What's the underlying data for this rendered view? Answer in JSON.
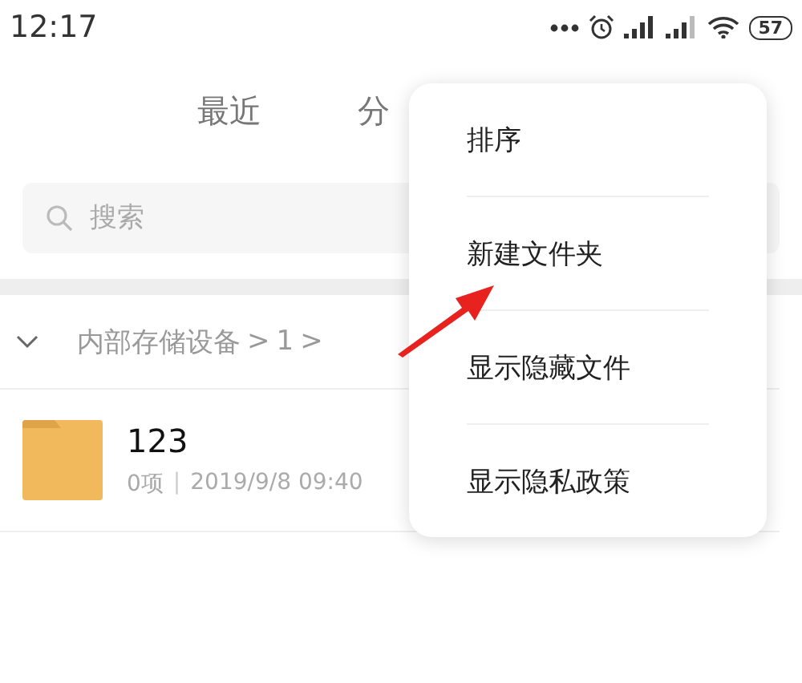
{
  "status_bar": {
    "time": "12:17",
    "battery": "57"
  },
  "tabs": [
    {
      "label": "最近",
      "selected": false
    },
    {
      "label": "分",
      "selected": false
    }
  ],
  "search": {
    "placeholder": "搜索"
  },
  "breadcrumb": [
    "内部存储设备",
    ">",
    "1",
    ">"
  ],
  "files": [
    {
      "name": "123",
      "count": "0项",
      "separator": "|",
      "modified": "2019/9/8 09:40"
    }
  ],
  "menu": {
    "items": [
      "排序",
      "新建文件夹",
      "显示隐藏文件",
      "显示隐私政策"
    ]
  }
}
